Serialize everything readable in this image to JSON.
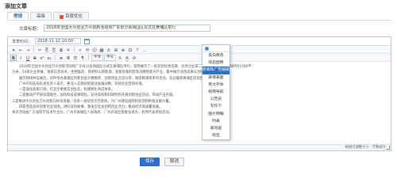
{
  "page": {
    "title": "添加文章"
  },
  "tabs": [
    {
      "label": "常规",
      "active": true
    },
    {
      "label": "高级",
      "active": false
    },
    {
      "label": "百度优化",
      "active": false
    }
  ],
  "form": {
    "title_label": "文章标题：",
    "title_value": "2018年全国大众创业万众创新活动周广东省分会场园区仪式在黄埔区举行"
  },
  "editor": {
    "date_label": "发表时间：",
    "date_value": "2018-11-12 20:50",
    "toolbar_row1": [
      "▾",
      "←",
      "→",
      "✂",
      "⎘",
      "⎗",
      "⧉",
      "✕",
      "⌕",
      "⟲",
      "☺",
      "▦",
      "⚓",
      "⊞",
      "⊕",
      "Ω",
      "?",
      "…"
    ],
    "toolbar_row2": [
      "B",
      "I",
      "U",
      "S",
      "x²",
      "x₂",
      "≡",
      "≣",
      "☰",
      "¶",
      "A",
      "A̲",
      "⊘"
    ],
    "font_select": "字体",
    "size_select": "字号",
    "content": [
      "2018年全国大众创业万众创新活动周广东省分会场园区仪式在黄埔区举行，现场展示了一批双创优秀成果，优秀企业第二次主要展览，展区面积约1500平",
      "方米，54家企业参展，涵盖信息技术、生物医药、新材料与新能源、智能装备制造等战略性新兴产业，集中展示双创成果与创新企业风采。",
      "展示现场共设展区，同时举办黄埔区创新创业大赛颁奖、创新创业交流分享、融资路演等系列活动，充分展现黄埔区双创生态。",
      "广州市科技局有关负责人表示，要深入实施创新驱动发展战略，持续优化营商环境。",
      "一是强化政策引领，打造全要素双创生态，构建孵化育成体系。",
      "二是推动产学研深度融合，加快科技成果转化，支持高校和科研院所开展创新创业活动，带动产业升级。",
      "三是推进大众创业万众创新向纵深发展，培育一批双创示范基地，为广州建设国际科技创新枢纽贡献力量。",
      "四是营造良好创新创业氛围，讲好双创故事，激发全社会创新创业活力，推动经济高质量发展。",
      "本次活动由广东省科学技术厅主办，广州市黄埔区人民政府、广州开发区管委会承办，各界代表参加活动。"
    ],
    "status": "拖拽可调整大小 · 字数统计"
  },
  "dropdown": {
    "items": [
      {
        "label": "黑白教育",
        "highlighted": false
      },
      {
        "label": "动态图像",
        "highlighted": false
      },
      {
        "label": "新闻和广告编辑力",
        "highlighted": true
      },
      {
        "label": "表情表面",
        "highlighted": false
      },
      {
        "label": "英文字体",
        "highlighted": false
      },
      {
        "label": "视频导航",
        "highlighted": false
      },
      {
        "label": "公告员",
        "highlighted": false
      },
      {
        "label": "写作下",
        "highlighted": false
      },
      {
        "label": "图片明细",
        "highlighted": false
      },
      {
        "label": "时表",
        "highlighted": false
      },
      {
        "label": "表哥画",
        "highlighted": false
      },
      {
        "label": "标签",
        "highlighted": false
      }
    ]
  },
  "buttons": {
    "save": "保存",
    "cancel": "取消"
  },
  "colors": {
    "accent": "#2e6fd0",
    "highlight": "#2f6fc6",
    "border": "#bdc7d4"
  }
}
